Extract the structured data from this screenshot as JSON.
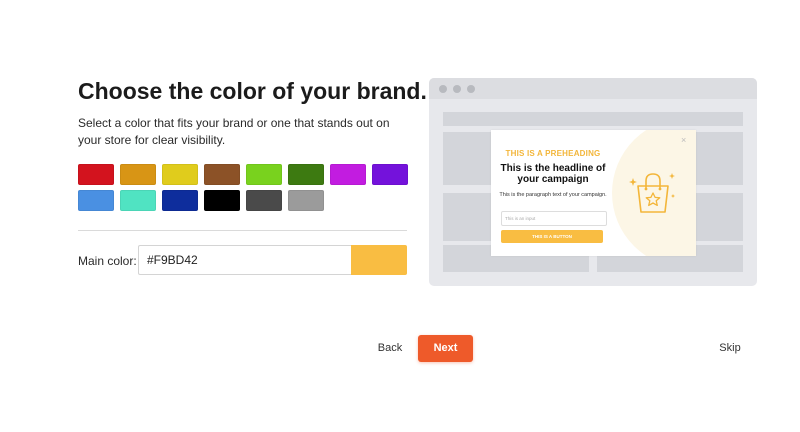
{
  "header": {
    "title": "Choose the color of your brand.",
    "description": "Select a color that fits your brand or one that stands out on your store for clear visibility."
  },
  "swatches": [
    {
      "color": "#D3131E"
    },
    {
      "color": "#D89515"
    },
    {
      "color": "#E0CC1C"
    },
    {
      "color": "#8C5227"
    },
    {
      "color": "#79D21E"
    },
    {
      "color": "#3D7A11"
    },
    {
      "color": "#C21CE0"
    },
    {
      "color": "#7412DB"
    },
    {
      "color": "#4A90E2"
    },
    {
      "color": "#50E3C2"
    },
    {
      "color": "#0E2D9C"
    },
    {
      "color": "#000000"
    },
    {
      "color": "#4A4A4A"
    },
    {
      "color": "#9B9B9B"
    }
  ],
  "main_color": {
    "label": "Main color:",
    "value": "#F9BD42",
    "preview_color": "#F9BD42"
  },
  "preview": {
    "preheading": "THIS IS A PREHEADING",
    "headline": "This is the headline of your campaign",
    "paragraph": "This is the paragraph text of your campaign.",
    "input_placeholder": "This is an input",
    "button_label": "THIS IS A BUTTON",
    "close_icon": "×",
    "accent_color": "#F9BD42"
  },
  "nav": {
    "back": "Back",
    "next": "Next",
    "skip": "Skip",
    "next_color": "#EE5A2A"
  }
}
